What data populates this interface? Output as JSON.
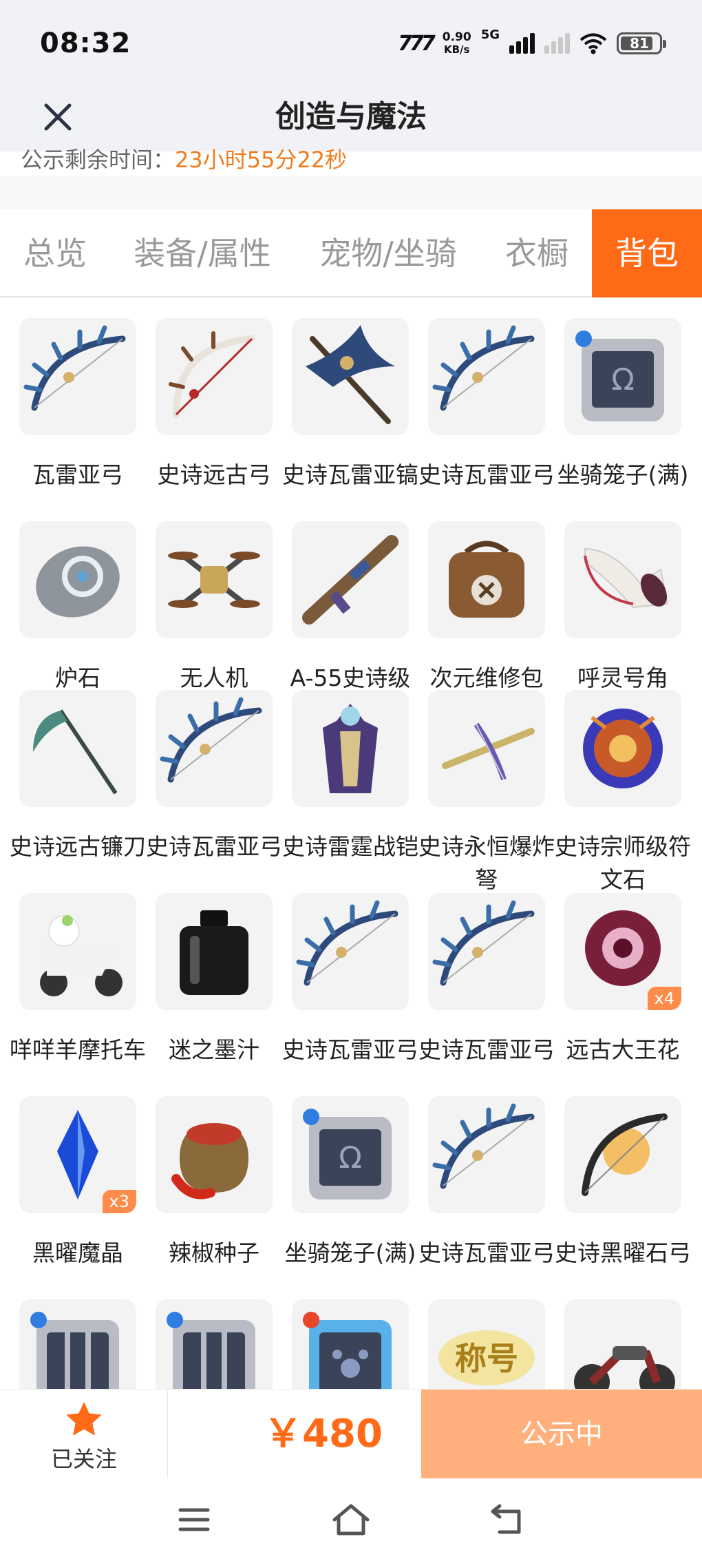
{
  "status_bar": {
    "time": "08:32",
    "speed_value": "0.90",
    "speed_unit": "KB/s",
    "network": "5G",
    "battery": "81"
  },
  "header": {
    "title": "创造与魔法"
  },
  "countdown": {
    "label": "公示剩余时间：",
    "value": "23小时55分22秒"
  },
  "tabs": [
    {
      "label": "总览",
      "active": false
    },
    {
      "label": "装备/属性",
      "active": false
    },
    {
      "label": "宠物/坐骑",
      "active": false
    },
    {
      "label": "衣橱",
      "active": false
    },
    {
      "label": "背包",
      "active": true
    }
  ],
  "items": [
    {
      "name": "瓦雷亚弓",
      "icon": "blue-feather-bow-icon"
    },
    {
      "name": "史诗远古弓",
      "icon": "ancient-bow-icon"
    },
    {
      "name": "史诗瓦雷亚镐",
      "icon": "blue-pickaxe-icon"
    },
    {
      "name": "史诗瓦雷亚弓",
      "icon": "blue-feather-bow-icon"
    },
    {
      "name": "坐骑笼子(满)",
      "icon": "mount-cage-icon"
    },
    {
      "name": "炉石",
      "icon": "hearthstone-icon"
    },
    {
      "name": "无人机",
      "icon": "drone-icon"
    },
    {
      "name": "A-55史诗级",
      "icon": "rifle-icon"
    },
    {
      "name": "次元维修包",
      "icon": "repair-bag-icon"
    },
    {
      "name": "呼灵号角",
      "icon": "horn-icon"
    },
    {
      "name": "史诗远古镰刀",
      "icon": "scythe-icon"
    },
    {
      "name": "史诗瓦雷亚弓",
      "icon": "blue-feather-bow-icon"
    },
    {
      "name": "史诗雷霆战铠",
      "icon": "armor-icon"
    },
    {
      "name": "史诗永恒爆炸弩",
      "icon": "crossbow-icon"
    },
    {
      "name": "史诗宗师级符文石",
      "icon": "rune-stone-icon"
    },
    {
      "name": "咩咩羊摩托车",
      "icon": "sheep-scooter-icon"
    },
    {
      "name": "迷之墨汁",
      "icon": "ink-bottle-icon"
    },
    {
      "name": "史诗瓦雷亚弓",
      "icon": "blue-feather-bow-icon"
    },
    {
      "name": "史诗瓦雷亚弓",
      "icon": "blue-feather-bow-icon"
    },
    {
      "name": "远古大王花",
      "icon": "rafflesia-icon",
      "badge": "x4"
    },
    {
      "name": "黑曜魔晶",
      "icon": "blue-crystal-icon",
      "badge": "x3"
    },
    {
      "name": "辣椒种子",
      "icon": "pepper-seed-bag-icon"
    },
    {
      "name": "坐骑笼子(满)",
      "icon": "mount-cage-icon"
    },
    {
      "name": "史诗瓦雷亚弓",
      "icon": "blue-feather-bow-icon"
    },
    {
      "name": "史诗黑曜石弓",
      "icon": "obsidian-bow-icon"
    },
    {
      "name": "",
      "icon": "empty-cage-icon"
    },
    {
      "name": "",
      "icon": "empty-cage-icon"
    },
    {
      "name": "",
      "icon": "pet-cage-icon"
    },
    {
      "name": "",
      "icon": "title-badge-icon",
      "text": "称号"
    },
    {
      "name": "",
      "icon": "motorcycle-icon"
    }
  ],
  "bottom_bar": {
    "follow_label": "已关注",
    "price": "￥480",
    "status_button": "公示中"
  },
  "colors": {
    "accent": "#ff6a17",
    "countdown": "#f07c1e",
    "status_button": "#ffb07c",
    "header_bg": "#f0f2f5"
  }
}
